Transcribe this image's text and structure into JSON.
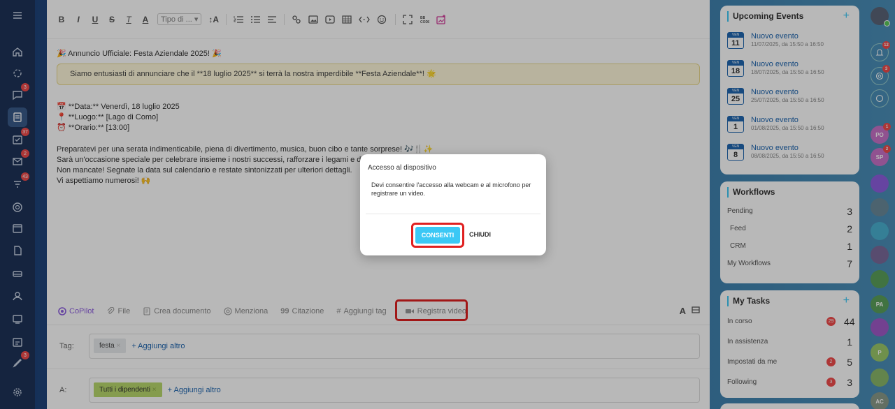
{
  "leftbar": {
    "items": [
      {
        "icon": "menu-icon",
        "badge": ""
      },
      {
        "icon": "home-icon",
        "badge": ""
      },
      {
        "icon": "copilot-icon",
        "badge": ""
      },
      {
        "icon": "chat-icon",
        "badge": "3"
      },
      {
        "icon": "feed-icon",
        "badge": ""
      },
      {
        "icon": "tasks-icon",
        "badge": "37"
      },
      {
        "icon": "mail-icon",
        "badge": "2"
      },
      {
        "icon": "crm-icon",
        "badge": "43"
      },
      {
        "icon": "marketing-icon",
        "badge": ""
      },
      {
        "icon": "calendar-icon",
        "badge": ""
      },
      {
        "icon": "documents-icon",
        "badge": ""
      },
      {
        "icon": "storage-icon",
        "badge": ""
      },
      {
        "icon": "employees-icon",
        "badge": ""
      },
      {
        "icon": "automation-icon",
        "badge": ""
      },
      {
        "icon": "booking-icon",
        "badge": ""
      },
      {
        "icon": "signature-icon",
        "badge": "3"
      },
      {
        "icon": "settings-icon",
        "badge": ""
      }
    ]
  },
  "toolbar": {
    "bold": "B",
    "italic": "I",
    "underline": "U",
    "strike": "S",
    "clear": "T",
    "color": "A",
    "font_select": "Tipo di ...",
    "size": "↕A"
  },
  "post": {
    "headline": "🎉 Annuncio Ufficiale: Festa Aziendale 2025! 🎉",
    "quote": "Siamo entusiasti di annunciare che il **18 luglio 2025** si terrà la nostra imperdibile **Festa Aziendale**! 🌟",
    "date_line": "📅 **Data:** Venerdì, 18 luglio 2025",
    "place_line": "📍 **Luogo:** [Lago di Como]",
    "time_line": "⏰ **Orario:** [13:00]",
    "p1": "Preparatevi per una serata indimenticabile, piena di divertimento, musica, buon cibo e tante sorprese! 🎶🍴✨",
    "p2": "Sarà un'occasione speciale per celebrare insieme i nostri successi, rafforzare i legami e diverti",
    "p3": "Non mancate! Segnate la data sul calendario e restate sintonizzati per ulteriori dettagli.",
    "p4": "Vi aspettiamo numerosi! 🙌"
  },
  "actions": {
    "copilot": "CoPilot",
    "file": "File",
    "create_doc": "Crea documento",
    "mention": "Menziona",
    "quote": "Citazione",
    "add_tag": "Aggiungi tag",
    "record_video": "Registra video"
  },
  "tags_row": {
    "label": "Tag:",
    "tag": "festa",
    "add_more": "+ Aggiungi altro"
  },
  "to_row": {
    "label": "A:",
    "recipient": "Tutti i dipendenti",
    "add_more": "+ Aggiungi altro"
  },
  "dialog": {
    "title": "Accesso al dispositivo",
    "text": "Devi consentire l'accesso alla webcam e al microfono per registrare un video.",
    "ok": "CONSENTI",
    "close": "CHIUDI"
  },
  "events": {
    "title": "Upcoming Events",
    "items": [
      {
        "month": "VEN",
        "day": "11",
        "title": "Nuovo evento",
        "time": "11/07/2025, da 15:50 a 16:50"
      },
      {
        "month": "VEN",
        "day": "18",
        "title": "Nuovo evento",
        "time": "18/07/2025, da 15:50 a 16:50"
      },
      {
        "month": "VEN",
        "day": "25",
        "title": "Nuovo evento",
        "time": "25/07/2025, da 15:50 a 16:50"
      },
      {
        "month": "VEN",
        "day": "1",
        "title": "Nuovo evento",
        "time": "01/08/2025, da 15:50 a 16:50"
      },
      {
        "month": "VEN",
        "day": "8",
        "title": "Nuovo evento",
        "time": "08/08/2025, da 15:50 a 16:50"
      }
    ]
  },
  "workflows": {
    "title": "Workflows",
    "rows": [
      {
        "label": "Pending",
        "value": "3"
      },
      {
        "label": "Feed",
        "value": "2"
      },
      {
        "label": "CRM",
        "value": "1"
      },
      {
        "label": "My Workflows",
        "value": "7"
      }
    ]
  },
  "tasks": {
    "title": "My Tasks",
    "rows": [
      {
        "label": "In corso",
        "badge": "29",
        "value": "44"
      },
      {
        "label": "In assistenza",
        "badge": "",
        "value": "1"
      },
      {
        "label": "Impostati da me",
        "badge": "2",
        "value": "5"
      },
      {
        "label": "Following",
        "badge": "3",
        "value": "3"
      }
    ]
  },
  "rightbar": {
    "items": [
      {
        "label": "",
        "badge": "",
        "color": "#5a6478"
      },
      {
        "label": "",
        "badge": "12",
        "color": "#3d6a9a"
      },
      {
        "label": "",
        "badge": "3",
        "color": "#3d6a9a"
      },
      {
        "label": "",
        "badge": "",
        "color": "#3d6a9a"
      },
      {
        "label": "PO",
        "badge": "1",
        "color": "#c872c8"
      },
      {
        "label": "SP",
        "badge": "2",
        "color": "#c872c8"
      },
      {
        "label": "",
        "badge": "",
        "color": "#8e5fe0"
      },
      {
        "label": "",
        "badge": "",
        "color": "#6a8a9a"
      },
      {
        "label": "",
        "badge": "",
        "color": "#4ab0d0"
      },
      {
        "label": "",
        "badge": "",
        "color": "#7a6a9a"
      },
      {
        "label": "",
        "badge": "",
        "color": "#5aa05a"
      },
      {
        "label": "PA",
        "badge": "",
        "color": "#5aa05a"
      },
      {
        "label": "",
        "badge": "",
        "color": "#a05ac8"
      },
      {
        "label": "P",
        "badge": "",
        "color": "#9ac86a"
      },
      {
        "label": "",
        "badge": "",
        "color": "#8ab86a"
      },
      {
        "label": "AC",
        "badge": "",
        "color": "#8a9a8a"
      }
    ]
  }
}
